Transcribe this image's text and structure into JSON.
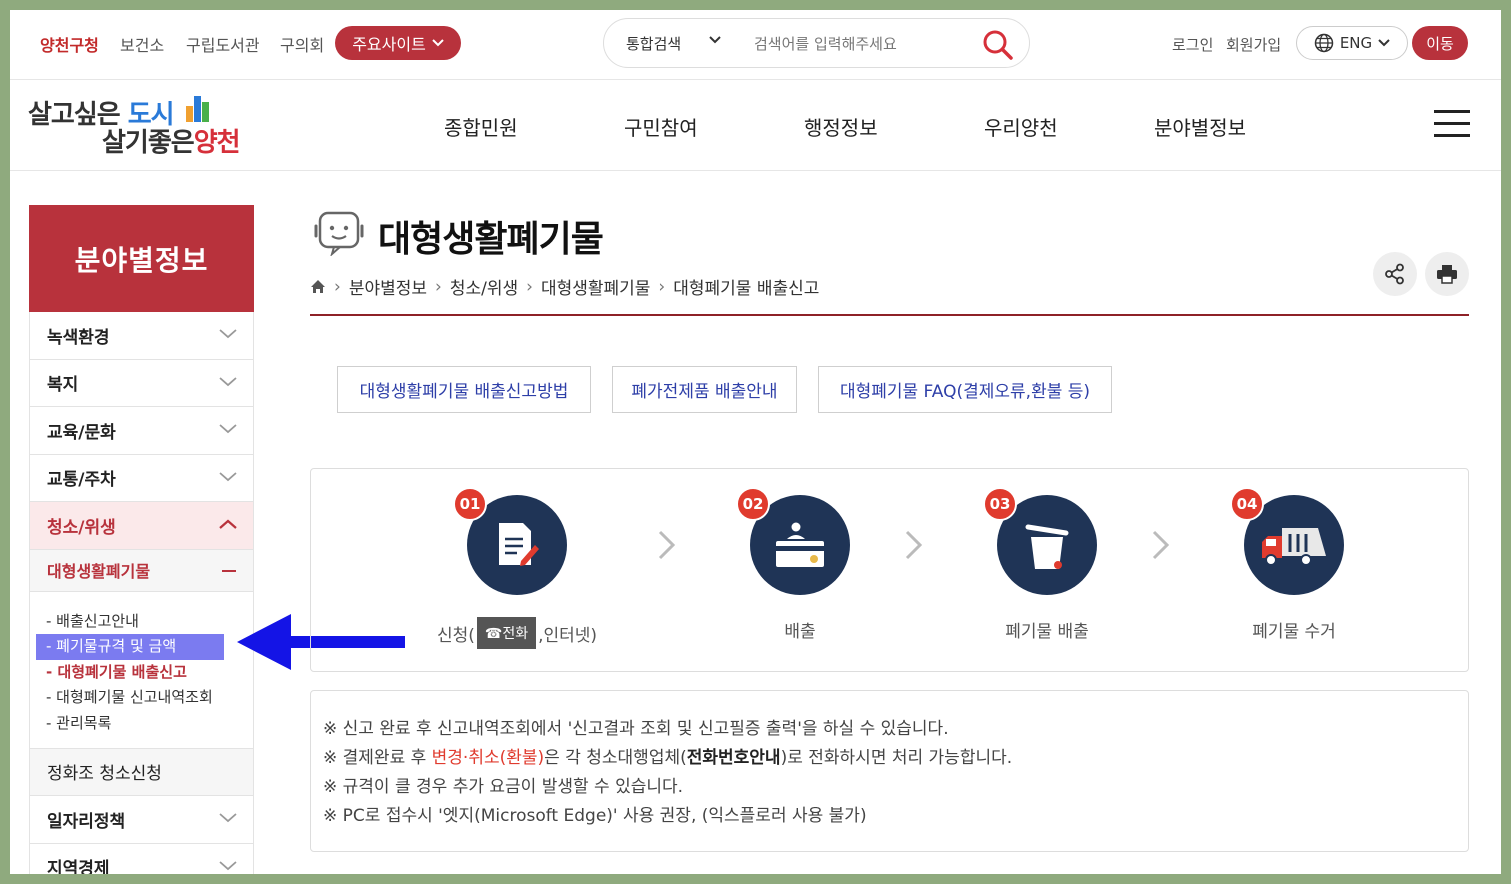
{
  "topbar": {
    "links": [
      "양천구청",
      "보건소",
      "구립도서관",
      "구의회"
    ],
    "major_sites": "주요사이트",
    "search_scope": "통합검색",
    "search_placeholder": "검색어를 입력해주세요",
    "login": "로그인",
    "join": "회원가입",
    "lang": "ENG",
    "go": "이동"
  },
  "logo": {
    "line1_a": "살고싶은 ",
    "line1_b": "도시",
    "line2_a": "살기좋은",
    "line2_b": "양천"
  },
  "gnb": [
    "종합민원",
    "구민참여",
    "행정정보",
    "우리양천",
    "분야별정보"
  ],
  "sidebar": {
    "title": "분야별정보",
    "items_top": [
      "녹색환경",
      "복지",
      "교육/문화",
      "교통/주차"
    ],
    "active": "청소/위생",
    "sub": "대형생활폐기물",
    "links": [
      "- 배출신고안내",
      "- 폐기물규격 및 금액",
      "- 대형폐기물 배출신고",
      "- 대형폐기물 신고내역조회",
      "- 관리목록"
    ],
    "plain_item": "정화조 청소신청",
    "items_bottom": [
      "일자리정책",
      "지역경제"
    ]
  },
  "page": {
    "title": "대형생활폐기물",
    "breadcrumb": [
      "분야별정보",
      "청소/위생",
      "대형생활폐기물",
      "대형폐기물 배출신고"
    ]
  },
  "tabs": [
    "대형생활폐기물 배출신고방법",
    "폐가전제품 배출안내",
    "대형폐기물 FAQ(결제오류,환불 등)"
  ],
  "steps": [
    {
      "num": "01",
      "label_a": "신청(",
      "badge": "☎전화",
      "label_b": ",인터넷)"
    },
    {
      "num": "02",
      "label": "배출"
    },
    {
      "num": "03",
      "label": "폐기물 배출"
    },
    {
      "num": "04",
      "label": "폐기물 수거"
    }
  ],
  "notes": {
    "n1": "※ 신고 완료 후 신고내역조회에서 '신고결과 조회 및 신고필증 출력'을 하실 수 있습니다.",
    "n2_a": "※ 결제완료 후 ",
    "n2_red": "변경·취소(환불)",
    "n2_b": "은 각 청소대행업체(",
    "n2_bold": "전화번호안내",
    "n2_c": ")로 전화하시면 처리 가능합니다.",
    "n3": "※ 규격이 클 경우 추가 요금이 발생할 수 있습니다.",
    "n4": "※ PC로 접수시 '엣지(Microsoft Edge)' 사용 권장, (익스플로러 사용 불가)"
  },
  "colors": {
    "brand_red": "#b8323c",
    "navy": "#1f3456",
    "highlight": "#7b7bf0",
    "arrow": "#1414e6"
  }
}
